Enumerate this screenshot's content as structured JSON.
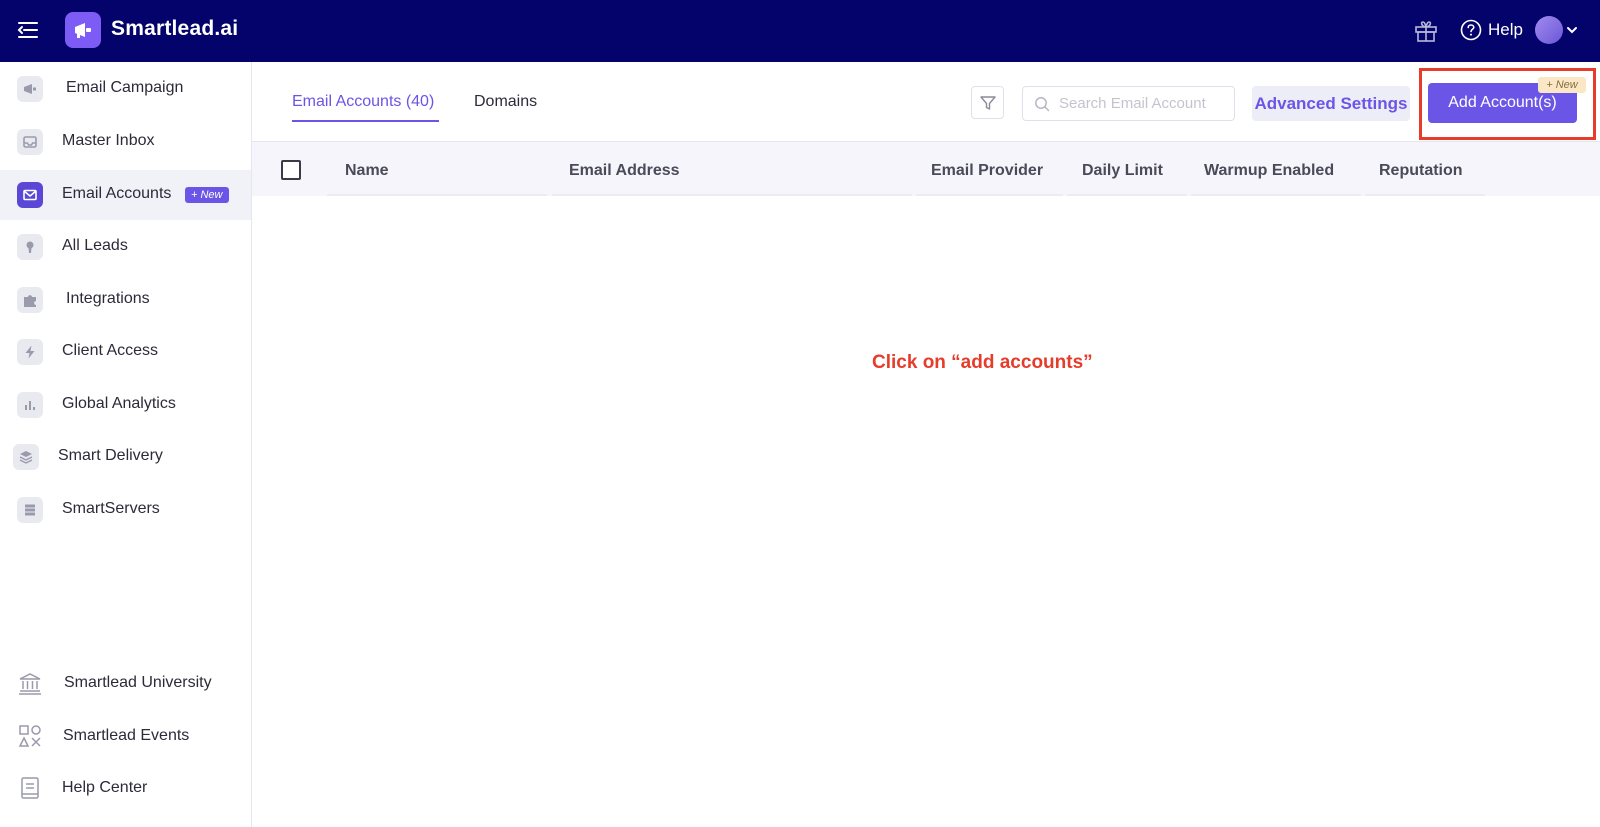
{
  "app": {
    "name": "Smartlead.ai",
    "help_label": "Help"
  },
  "sidebar": {
    "items": [
      {
        "label": "Email Campaign",
        "icon": "megaphone-icon"
      },
      {
        "label": "Master Inbox",
        "icon": "inbox-icon"
      },
      {
        "label": "Email Accounts",
        "icon": "envelope-icon",
        "badge": "+ New",
        "active": true
      },
      {
        "label": "All Leads",
        "icon": "leads-icon"
      },
      {
        "label": "Integrations",
        "icon": "puzzle-icon"
      },
      {
        "label": "Client Access",
        "icon": "bolt-icon"
      },
      {
        "label": "Global Analytics",
        "icon": "bar-chart-icon"
      },
      {
        "label": "Smart Delivery",
        "icon": "layers-icon"
      },
      {
        "label": "SmartServers",
        "icon": "server-icon"
      }
    ],
    "bottom_items": [
      {
        "label": "Smartlead University",
        "icon": "university-icon"
      },
      {
        "label": "Smartlead Events",
        "icon": "shapes-icon"
      },
      {
        "label": "Help Center",
        "icon": "book-icon"
      }
    ]
  },
  "tabs": {
    "email_accounts": "Email Accounts (40)",
    "domains": "Domains"
  },
  "toolbar": {
    "search_placeholder": "Search Email Account",
    "advanced_settings": "Advanced Settings",
    "add_account": "Add Account(s)",
    "add_badge": "+ New"
  },
  "table": {
    "columns": [
      "Name",
      "Email Address",
      "Email Provider",
      "Daily Limit",
      "Warmup Enabled",
      "Reputation"
    ]
  },
  "annotation": "Click on “add accounts”",
  "colors": {
    "topbar": "#03036b",
    "accent": "#6b55e6",
    "highlight": "#e53c2b"
  }
}
